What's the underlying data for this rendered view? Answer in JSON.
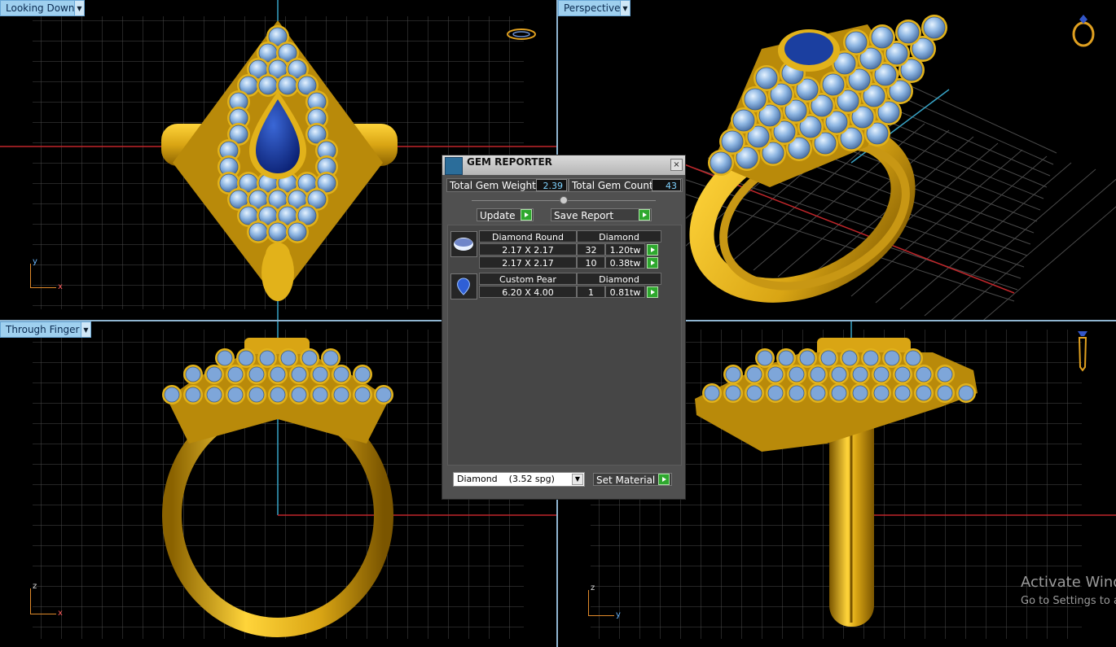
{
  "viewports": {
    "top_left": {
      "label": "Looking Down"
    },
    "top_right": {
      "label": "Perspective"
    },
    "bottom_left": {
      "label": "Through Finger"
    },
    "bottom_right": {
      "label": ""
    }
  },
  "axes": {
    "top_left": {
      "v": "y",
      "h": "x"
    },
    "bottom_left": {
      "v": "z",
      "h": "x"
    },
    "bottom_right": {
      "v": "z",
      "h": "y"
    }
  },
  "gem_reporter": {
    "title": "GEM REPORTER",
    "close_glyph": "×",
    "total_weight_label": "Total Gem Weight",
    "total_weight_value": "2.39",
    "total_count_label": "Total Gem Count",
    "total_count_value": "43",
    "update_label": "Update",
    "save_report_label": "Save Report",
    "groups": [
      {
        "icon": "round-gem-icon",
        "shape": "Diamond Round",
        "material": "Diamond",
        "rows": [
          {
            "size": "2.17 X 2.17",
            "count": "32",
            "weight": "1.20tw"
          },
          {
            "size": "2.17 X 2.17",
            "count": "10",
            "weight": "0.38tw"
          }
        ]
      },
      {
        "icon": "pear-gem-icon",
        "shape": "Custom Pear",
        "material": "Diamond",
        "rows": [
          {
            "size": "6.20 X 4.00",
            "count": "1",
            "weight": "0.81tw"
          }
        ]
      }
    ],
    "material_select": "Diamond    (3.52 spg)",
    "set_material_label": "Set Material"
  },
  "watermark": {
    "line1": "Activate Windows",
    "line2": "Go to Settings to activate Windows."
  },
  "colors": {
    "gold": "#d9a514",
    "gem_light": "#8fb7e3",
    "gem_blue": "#1b3fa0",
    "grid": "#4a4a4a",
    "accent_play": "#2ea82e"
  }
}
